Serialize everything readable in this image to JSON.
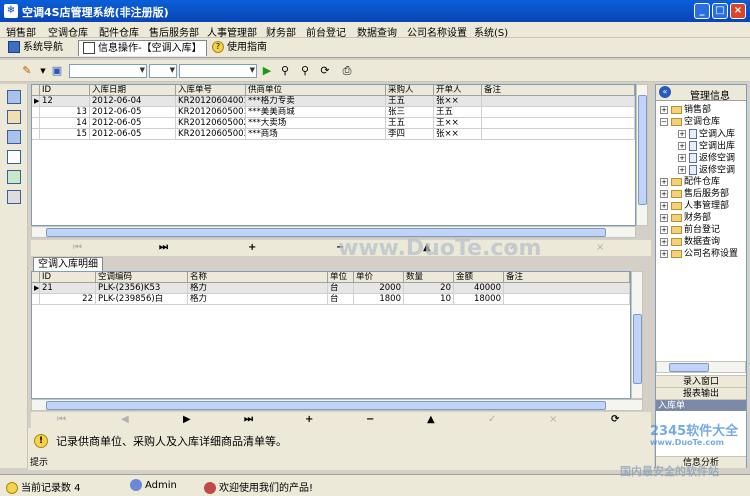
{
  "window": {
    "title": "空调4S店管理系统(非注册版)"
  },
  "menu": [
    "销售部",
    "空调仓库",
    "配件仓库",
    "售后服务部",
    "人事管理部",
    "财务部",
    "前台登记",
    "数据查询",
    "公司名称设置",
    "系统(S)"
  ],
  "tabs": {
    "nav": "系统导航",
    "active": "信息操作-【空调入库】",
    "guide": "使用指南"
  },
  "master": {
    "headers": [
      "ID",
      "入库日期",
      "入库单号",
      "供商单位",
      "采购人",
      "开单人",
      "备注"
    ],
    "rows": [
      [
        "12",
        "2012-06-04",
        "KR20120604001",
        "***格力专卖",
        "王五",
        "张××",
        ""
      ],
      [
        "13",
        "2012-06-05",
        "KR20120605001",
        "***美美商城",
        "张三",
        "王五",
        ""
      ],
      [
        "14",
        "2012-06-05",
        "KR20120605002",
        "***大卖场",
        "王五",
        "王××",
        ""
      ],
      [
        "15",
        "2012-06-05",
        "KR20120605003",
        "***商场",
        "李四",
        "张××",
        ""
      ]
    ]
  },
  "detail": {
    "tab": "空调入库明细",
    "headers": [
      "ID",
      "空调编码",
      "名称",
      "单位",
      "单价",
      "数量",
      "金额",
      "备注"
    ],
    "rows": [
      [
        "21",
        "PLK-(2356)K53",
        "格力",
        "台",
        "2000",
        "20",
        "40000",
        ""
      ],
      [
        "22",
        "PLK-(239856)白",
        "格力",
        "台",
        "1800",
        "10",
        "18000",
        ""
      ]
    ]
  },
  "right_panel": {
    "title": "管理信息",
    "tree": [
      "销售部",
      "空调仓库",
      "空调入库",
      "空调出库",
      "返修空调",
      "返修空调",
      "配件仓库",
      "售后服务部",
      "人事管理部",
      "财务部",
      "前台登记",
      "数据查询",
      "公司名称设置"
    ],
    "buttons": [
      "录入窗口",
      "报表输出",
      "入库单",
      "信息分析"
    ]
  },
  "tips": {
    "text": "记录供商单位、采购人及入库详细商品清单等。",
    "label": "提示"
  },
  "status": {
    "records": "当前记录数 4",
    "user": "Admin",
    "welcome": "欢迎使用我们的产品!"
  },
  "watermarks": [
    "www.DuoTe.com",
    "2345软件大全",
    "www.DuoTe.com",
    "国内最安全的软件站"
  ]
}
